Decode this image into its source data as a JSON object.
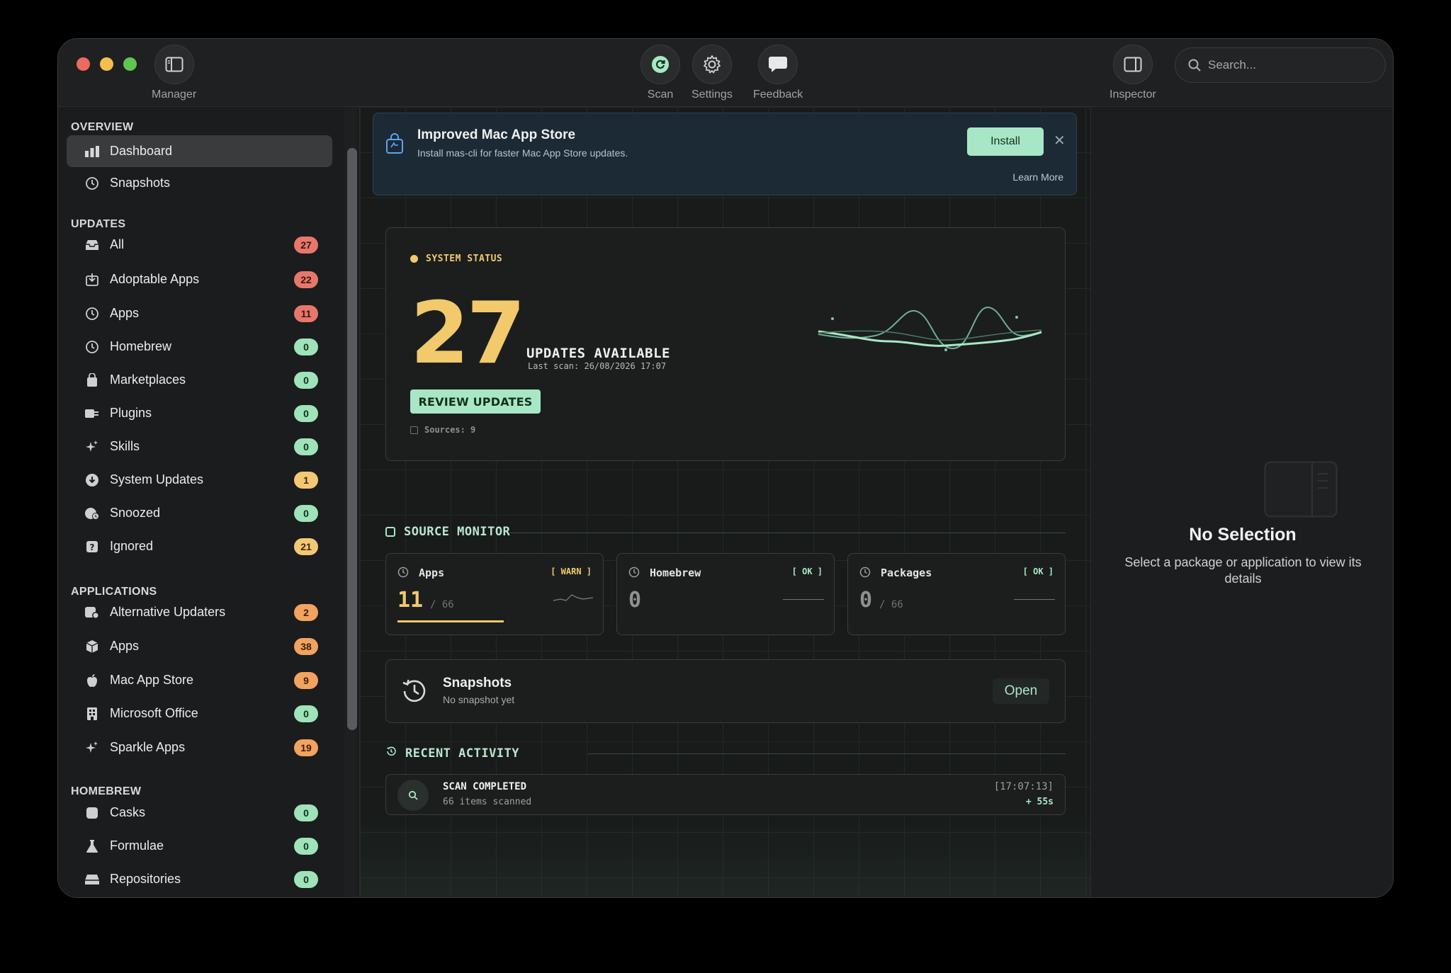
{
  "toolbar": {
    "manager_label": "Manager",
    "scan_label": "Scan",
    "settings_label": "Settings",
    "feedback_label": "Feedback",
    "inspector_label": "Inspector",
    "search_placeholder": "Search..."
  },
  "sidebar": {
    "sections": {
      "overview": "OVERVIEW",
      "updates": "UPDATES",
      "applications": "APPLICATIONS",
      "homebrew": "HOMEBREW"
    },
    "overview": [
      {
        "label": "Dashboard",
        "icon": "bar-chart-icon"
      },
      {
        "label": "Snapshots",
        "icon": "clock-icon"
      }
    ],
    "updates": [
      {
        "label": "All",
        "count": "27",
        "badge_color": "#e8776b"
      },
      {
        "label": "Adoptable Apps",
        "count": "22",
        "badge_color": "#e8776b"
      },
      {
        "label": "Apps",
        "count": "11",
        "badge_color": "#e8776b"
      },
      {
        "label": "Homebrew",
        "count": "0",
        "badge_color": "#9fe3b9"
      },
      {
        "label": "Marketplaces",
        "count": "0",
        "badge_color": "#9fe3b9"
      },
      {
        "label": "Plugins",
        "count": "0",
        "badge_color": "#9fe3b9"
      },
      {
        "label": "Skills",
        "count": "0",
        "badge_color": "#9fe3b9"
      },
      {
        "label": "System Updates",
        "count": "1",
        "badge_color": "#f3c875"
      },
      {
        "label": "Snoozed",
        "count": "0",
        "badge_color": "#9fe3b9"
      },
      {
        "label": "Ignored",
        "count": "21",
        "badge_color": "#f3c875"
      }
    ],
    "applications": [
      {
        "label": "Alternative Updaters",
        "count": "2",
        "badge_color": "#f2a35f"
      },
      {
        "label": "Apps",
        "count": "38",
        "badge_color": "#f2a35f"
      },
      {
        "label": "Mac App Store",
        "count": "9",
        "badge_color": "#f2a35f"
      },
      {
        "label": "Microsoft Office",
        "count": "0",
        "badge_color": "#9fe3b9"
      },
      {
        "label": "Sparkle Apps",
        "count": "19",
        "badge_color": "#f2a35f"
      }
    ],
    "homebrew": [
      {
        "label": "Casks",
        "count": "0",
        "badge_color": "#9fe3b9"
      },
      {
        "label": "Formulae",
        "count": "0",
        "badge_color": "#9fe3b9"
      },
      {
        "label": "Repositories",
        "count": "0",
        "badge_color": "#9fe3b9"
      }
    ]
  },
  "banner": {
    "title": "Improved Mac App Store",
    "subtitle": "Install mas-cli for faster Mac App Store updates.",
    "install_label": "Install",
    "close_symbol": "✕",
    "learn_more": "Learn More"
  },
  "status": {
    "label": "SYSTEM STATUS",
    "count": "27",
    "headline": "UPDATES AVAILABLE",
    "last_scan": "Last scan: 26/08/2026 17:07",
    "review_label": "REVIEW UPDATES",
    "sources": "Sources: 9"
  },
  "source_monitor": {
    "heading": "SOURCE MONITOR",
    "cards": [
      {
        "title": "Apps",
        "tag": "[ WARN ]",
        "value": "11",
        "total": "/ 66",
        "progress": 0.1667
      },
      {
        "title": "Homebrew",
        "tag": "[ OK ]",
        "value": "0",
        "total": ""
      },
      {
        "title": "Packages",
        "tag": "[ OK ]",
        "value": "0",
        "total": "/ 66"
      }
    ]
  },
  "snapshots": {
    "title": "Snapshots",
    "subtitle": "No snapshot yet",
    "open_label": "Open"
  },
  "recent_activity": {
    "heading": "RECENT ACTIVITY",
    "items": [
      {
        "title": "SCAN COMPLETED",
        "detail": "66 items scanned",
        "time": "[17:07:13]",
        "duration": "+ 55s"
      }
    ]
  },
  "inspector": {
    "title": "No Selection",
    "subtitle": "Select a package or application to view its details"
  },
  "colors": {
    "accent_green": "#a8e7c6",
    "accent_yellow": "#f2c96b",
    "banner_bg": "#1c2a36"
  }
}
